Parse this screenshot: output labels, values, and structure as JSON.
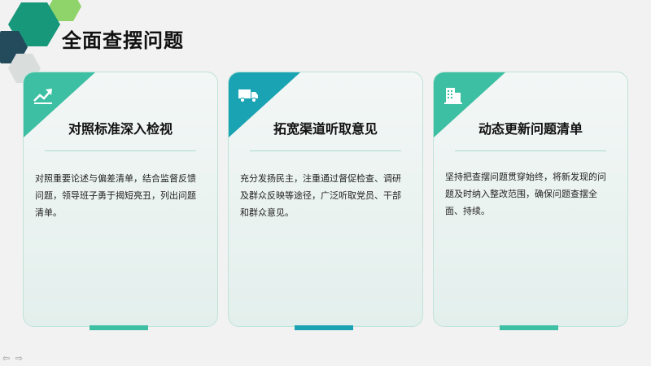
{
  "title": "全面查摆问题",
  "colors": {
    "teal": "#3dbfa3",
    "teal_dark": "#1f9e8a",
    "cyan": "#1aa3b3",
    "green": "#6cc24a",
    "navy": "#234b5c"
  },
  "cards": [
    {
      "heading": "对照标准深入检视",
      "icon": "trend-up-icon",
      "lines": [
        "对照重要论述与偏差清单，结合监督反馈",
        "问题，领导班子勇于揭短亮丑，列出问题",
        "清单。"
      ]
    },
    {
      "heading": "拓宽渠道听取意见",
      "icon": "truck-icon",
      "lines": [
        "充分发扬民主，注重通过督促检查、调研",
        "及群众反映等途径，广泛听取党员、干部",
        "和群众意见。"
      ]
    },
    {
      "heading": "动态更新问题清单",
      "icon": "building-icon",
      "lines": [
        "坚持把查摆问题贯穿始终，将新发现的问",
        "题及时纳入整改范围，确保问题查摆全",
        "面、持续。"
      ]
    }
  ],
  "nav": {
    "prev_icon": "arrow-left-icon",
    "next_icon": "arrow-right-icon",
    "prev_glyph": "⇦",
    "next_glyph": "⇨"
  }
}
